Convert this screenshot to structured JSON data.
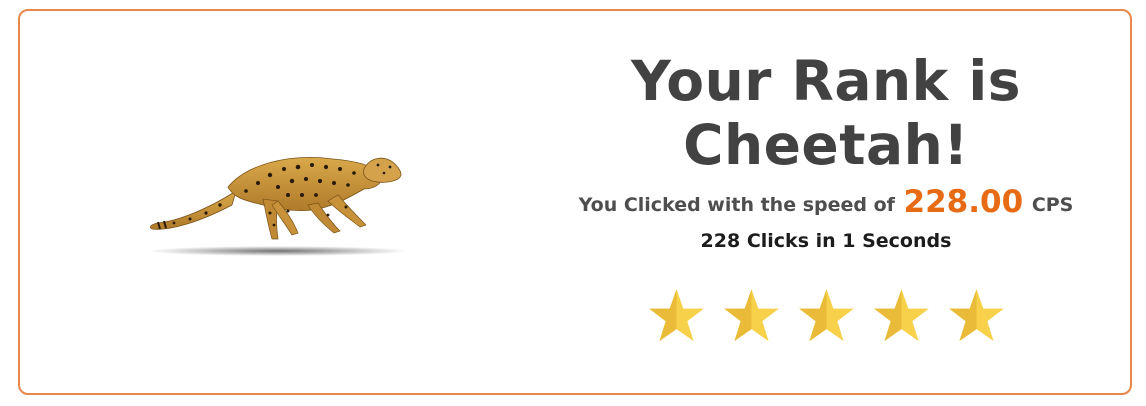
{
  "result": {
    "title": "Your Rank is Cheetah!",
    "speed_prefix": "You Clicked with the speed of",
    "speed_value": "228.00",
    "speed_unit": "CPS",
    "clicks_summary": "228 Clicks in 1 Seconds",
    "rating": 5,
    "rating_max": 5
  },
  "image": {
    "subject": "running-cheetah"
  },
  "colors": {
    "accent": "#e76b14",
    "border": "#e8884a",
    "star": "#f7d14a",
    "star_shade": "#e8b735",
    "title": "#424242"
  }
}
